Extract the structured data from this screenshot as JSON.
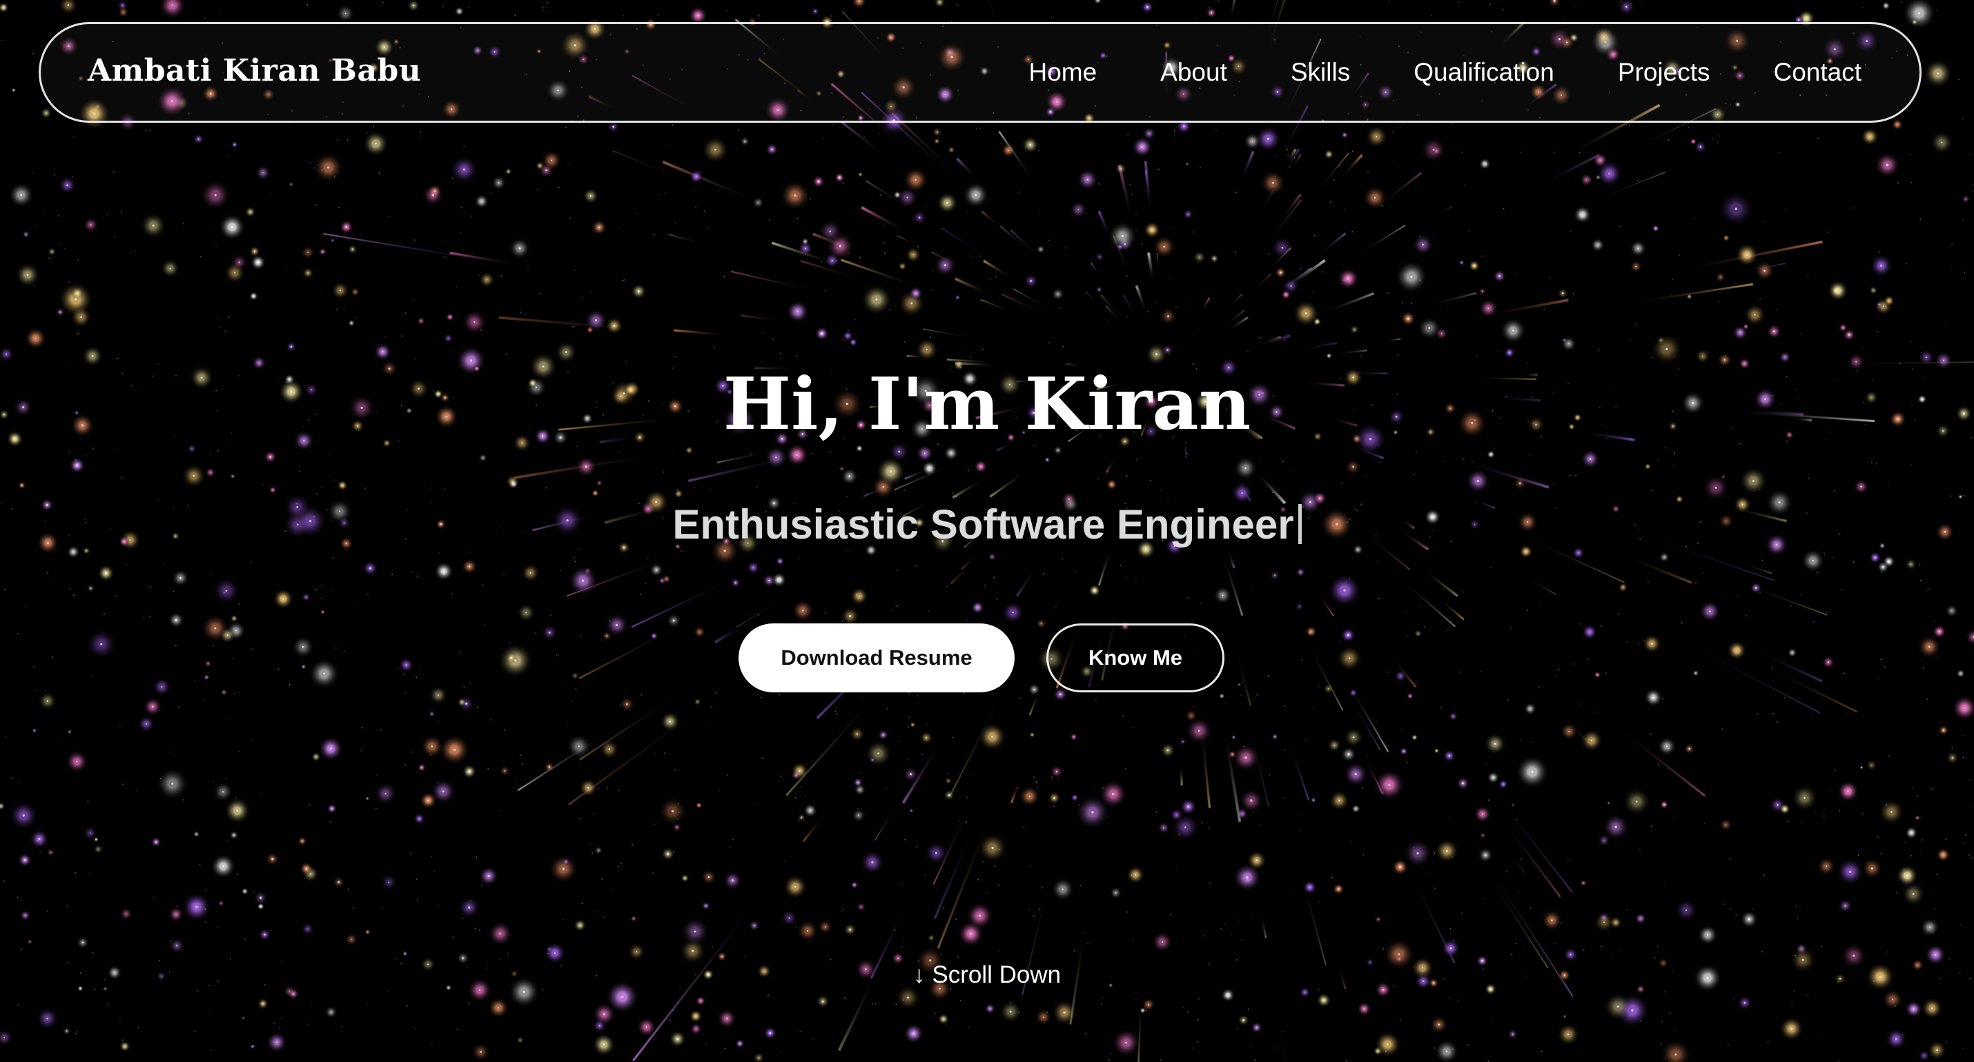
{
  "navbar": {
    "brand": "Ambati Kiran Babu",
    "links": [
      {
        "label": "Home"
      },
      {
        "label": "About"
      },
      {
        "label": "Skills"
      },
      {
        "label": "Qualification"
      },
      {
        "label": "Projects"
      },
      {
        "label": "Contact"
      }
    ]
  },
  "hero": {
    "title": "Hi, I'm Kiran",
    "subtitle": "Enthusiastic Software Engineer",
    "buttons": {
      "download_resume": "Download Resume",
      "know_me": "Know Me"
    },
    "scroll_down": {
      "arrow_icon": "arrow-down-icon",
      "arrow_glyph": "↓",
      "label": "Scroll Down"
    }
  },
  "colors": {
    "background": "#000000",
    "text": "#ffffff",
    "subtitle": "#dcdcdc",
    "button_primary_bg": "#ffffff",
    "button_primary_text": "#111111",
    "star_palette": [
      "#ffffff",
      "#d98cff",
      "#ffd27a",
      "#ff9b6b",
      "#b06bff",
      "#ff7fd1",
      "#fff3a8"
    ]
  }
}
